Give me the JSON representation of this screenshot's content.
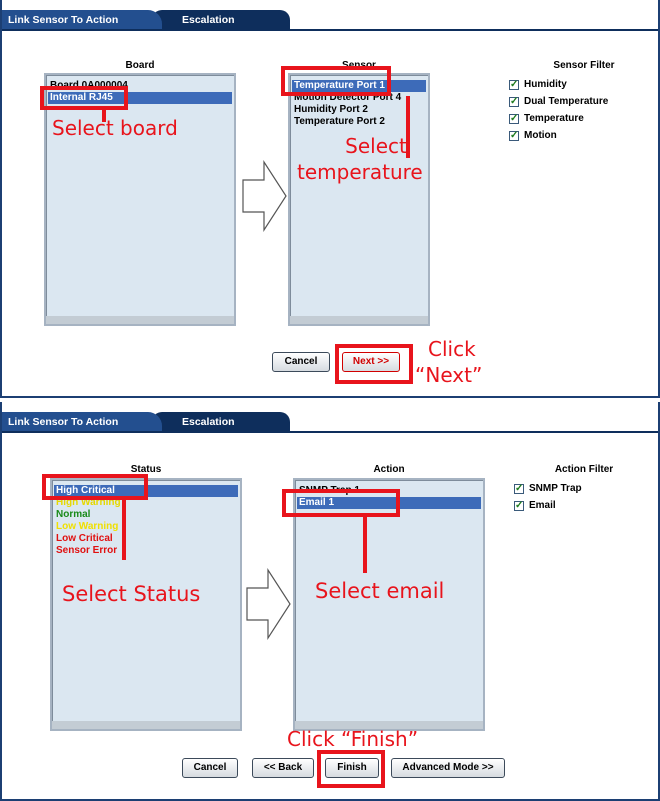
{
  "panel1": {
    "tabs": {
      "active": "Link Sensor To Action",
      "inactive": "Escalation"
    },
    "board": {
      "heading": "Board",
      "items": [
        {
          "label": "Board 0A000004"
        },
        {
          "label": "Internal RJ45",
          "selected": true
        }
      ]
    },
    "sensor": {
      "heading": "Sensor",
      "items": [
        {
          "label": "Temperature Port 1",
          "selected": true
        },
        {
          "label": "Motion Detector Port 4"
        },
        {
          "label": "Humidity Port 2"
        },
        {
          "label": "Temperature Port 2"
        }
      ]
    },
    "filter": {
      "heading": "Sensor Filter",
      "items": [
        {
          "label": "Humidity",
          "checked": true
        },
        {
          "label": "Dual Temperature",
          "checked": true
        },
        {
          "label": "Temperature",
          "checked": true
        },
        {
          "label": "Motion",
          "checked": true
        }
      ]
    },
    "buttons": {
      "cancel": "Cancel",
      "next": "Next >>"
    },
    "annotations": {
      "select_board": "Select board",
      "select_temperature_1": "Select",
      "select_temperature_2": "temperature",
      "click_next_1": "Click",
      "click_next_2": "“Next”"
    }
  },
  "panel2": {
    "tabs": {
      "active": "Link Sensor To Action",
      "inactive": "Escalation"
    },
    "status": {
      "heading": "Status",
      "items": [
        {
          "label": "High Critical",
          "selected": true,
          "color": "#ffffff"
        },
        {
          "label": "High Warning",
          "color": "#e6d800"
        },
        {
          "label": "Normal",
          "color": "#1a8a1a"
        },
        {
          "label": "Low Warning",
          "color": "#f0e000"
        },
        {
          "label": "Low Critical",
          "color": "#e01010"
        },
        {
          "label": "Sensor Error",
          "color": "#e01010"
        }
      ]
    },
    "action": {
      "heading": "Action",
      "items": [
        {
          "label": "SNMP Trap 1"
        },
        {
          "label": "Email 1",
          "selected": true
        }
      ]
    },
    "filter": {
      "heading": "Action Filter",
      "items": [
        {
          "label": "SNMP Trap",
          "checked": true
        },
        {
          "label": "Email",
          "checked": true
        }
      ]
    },
    "buttons": {
      "cancel": "Cancel",
      "back": "<< Back",
      "finish": "Finish",
      "advanced": "Advanced Mode >>"
    },
    "annotations": {
      "select_status": "Select Status",
      "select_email": "Select email",
      "click_finish": "Click “Finish”"
    }
  }
}
